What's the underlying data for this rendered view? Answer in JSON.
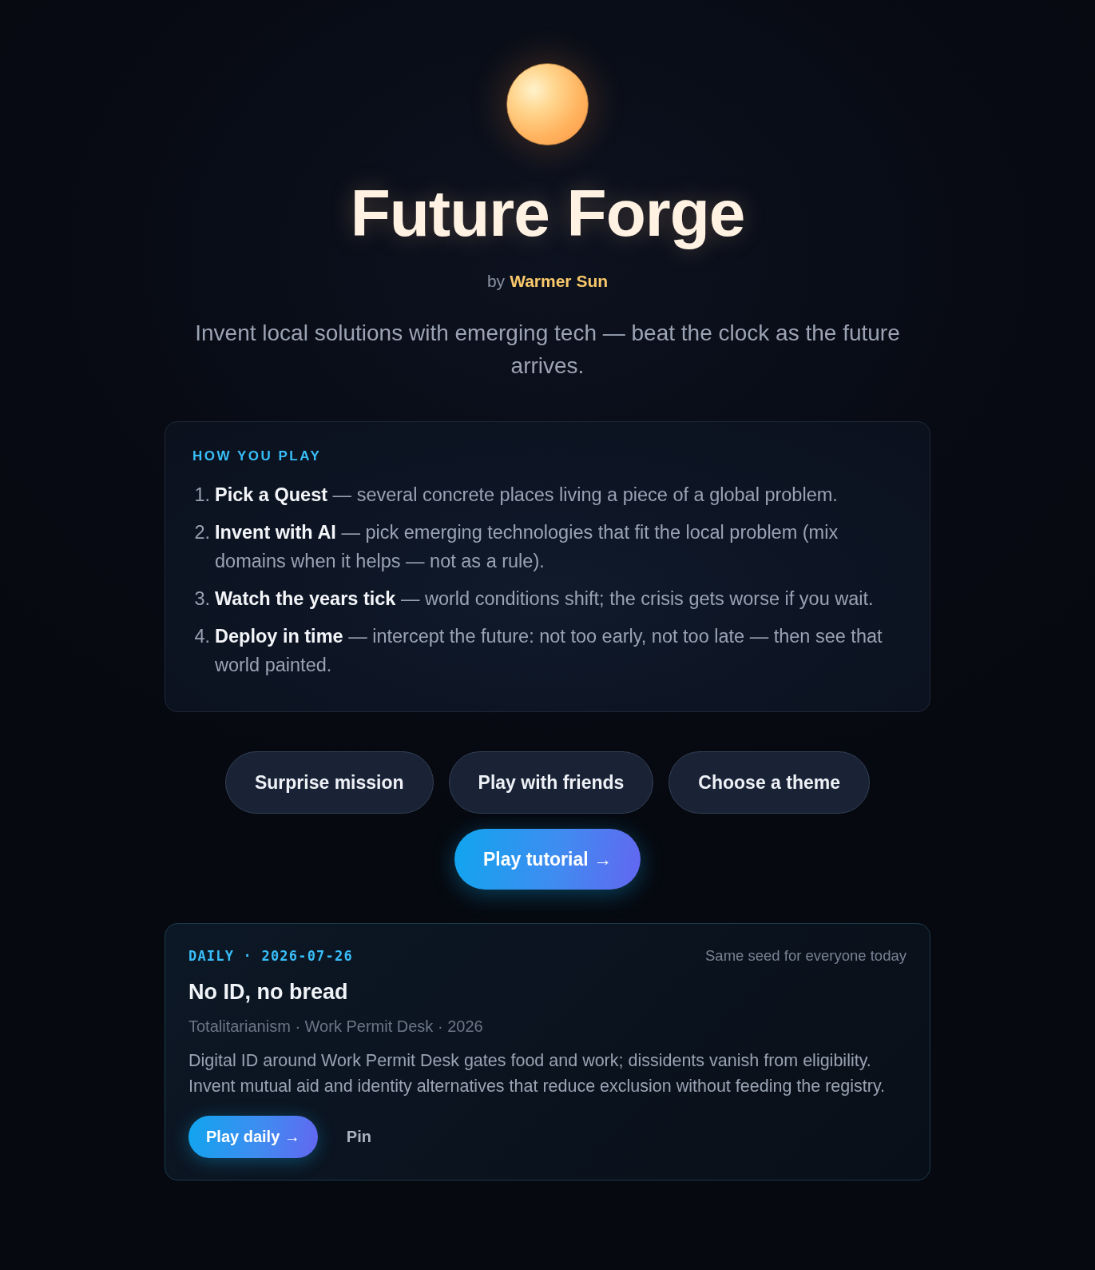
{
  "header": {
    "title": "Future Forge",
    "byline_prefix": "by",
    "author": "Warmer Sun",
    "tagline": "Invent local solutions with emerging tech — beat the clock as the future arrives."
  },
  "how_to_play": {
    "heading": "HOW YOU PLAY",
    "steps": [
      {
        "number": "1.",
        "text": "**Pick a Quest** — several concrete places living a piece of a global problem."
      },
      {
        "number": "2.",
        "text": "**Invent with AI** — pick emerging technologies that fit the local problem (mix domains when it helps — not as a rule)."
      },
      {
        "number": "3.",
        "text": "**Watch the years tick** — world conditions shift; the crisis gets worse if you wait."
      },
      {
        "number": "4.",
        "text": "**Deploy in time** — intercept the future: not too early, not too late — then see that world painted."
      }
    ]
  },
  "actions": [
    {
      "label": "Surprise mission",
      "kind": "secondary"
    },
    {
      "label": "Play with friends",
      "kind": "secondary"
    },
    {
      "label": "Choose a theme",
      "kind": "secondary"
    },
    {
      "label": "Play tutorial →",
      "kind": "primary"
    }
  ],
  "daily": {
    "tag": "DAILY · 2026-07-26",
    "note": "Same seed for everyone today",
    "title": "No ID, no bread",
    "meta": "Totalitarianism · Work Permit Desk · 2026",
    "description": "Digital ID around Work Permit Desk gates food and work; dissidents vanish from eligibility. Invent mutual aid and identity alternatives that reduce exclusion without feeding the registry.",
    "buttons": [
      {
        "label": "Play daily →",
        "kind": "primary"
      },
      {
        "label": "Pin",
        "kind": "plain"
      }
    ]
  }
}
